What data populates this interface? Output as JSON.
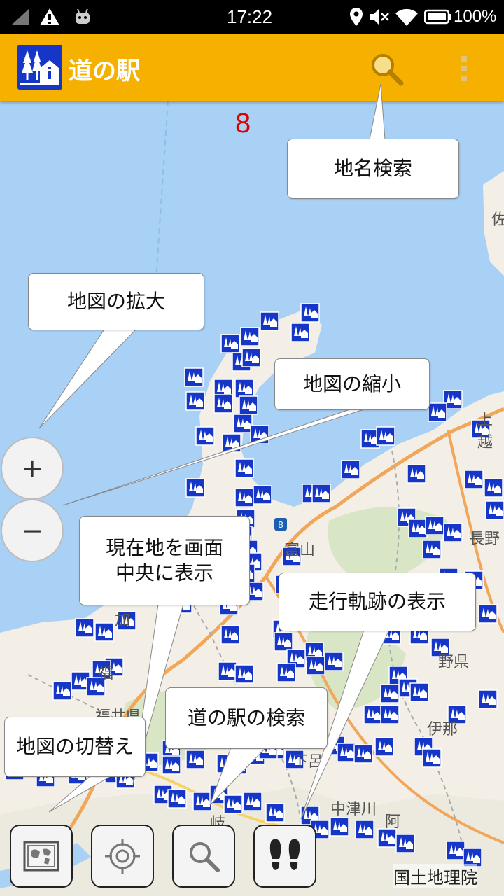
{
  "status_bar": {
    "time": "17:22",
    "battery": "100%",
    "icons": [
      "signal-icon",
      "warning-icon",
      "android-icon",
      "location-icon",
      "mute-icon",
      "wifi-icon",
      "battery-icon"
    ]
  },
  "app_bar": {
    "title": "道の駅",
    "icons": [
      "roadside-station-logo-icon",
      "search-icon",
      "overflow-menu-icon"
    ]
  },
  "map": {
    "zoom_level": "8",
    "labels": [
      "佐",
      "上越",
      "長野",
      "富山",
      "加",
      "福",
      "福井県",
      "伊那",
      "中津川",
      "野県",
      "岐",
      "阿",
      "下呂"
    ],
    "route_shield": "8",
    "attribution": "国土地理院"
  },
  "help_callouts": {
    "place_search": "地名検索",
    "zoom_in": "地図の拡大",
    "zoom_out": "地図の縮小",
    "center_location_line1": "現在地を画面",
    "center_location_line2": "中央に表示",
    "track_display": "走行軌跡の表示",
    "station_search": "道の駅の検索",
    "map_switch": "地図の切替え"
  },
  "controls": {
    "zoom_in_symbol": "+",
    "zoom_out_symbol": "−",
    "bottom_tools": [
      "map-switch-icon",
      "my-location-icon",
      "station-search-icon",
      "footprints-icon"
    ]
  },
  "colors": {
    "app_bar": "#f6b100",
    "sea": "#a9d0f5",
    "land": "#f3efe6",
    "marker": "#1636c8",
    "zoom_level_text": "#e00000"
  }
}
